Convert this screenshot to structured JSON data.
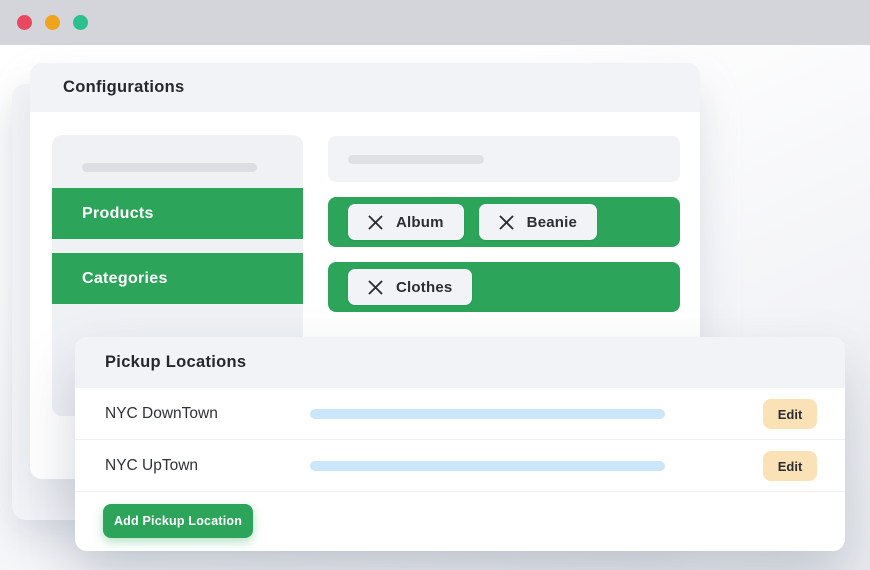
{
  "window": {
    "dots": [
      "red",
      "amber",
      "teal"
    ]
  },
  "configurations": {
    "title": "Configurations",
    "sidebar": {
      "items": [
        {
          "label": "Products"
        },
        {
          "label": "Categories"
        }
      ]
    },
    "tag_groups": [
      {
        "tags": [
          {
            "label": "Album"
          },
          {
            "label": "Beanie"
          }
        ]
      },
      {
        "tags": [
          {
            "label": "Clothes"
          }
        ]
      }
    ]
  },
  "pickup": {
    "title": "Pickup Locations",
    "rows": [
      {
        "name": "NYC DownTown",
        "action_label": "Edit"
      },
      {
        "name": "NYC UpTown",
        "action_label": "Edit"
      }
    ],
    "add_button_label": "Add Pickup Location"
  },
  "colors": {
    "accent_green": "#2ca55b",
    "chrome_bar": "#d3d5db",
    "dot_red": "#e8495f",
    "dot_amber": "#f0a31c",
    "dot_teal": "#2bc08d",
    "edit_button": "#fbe2b6",
    "address_bar_blue": "#cbe6fb",
    "panel_gray": "#eff1f5",
    "header_gray": "#f2f3f7"
  }
}
